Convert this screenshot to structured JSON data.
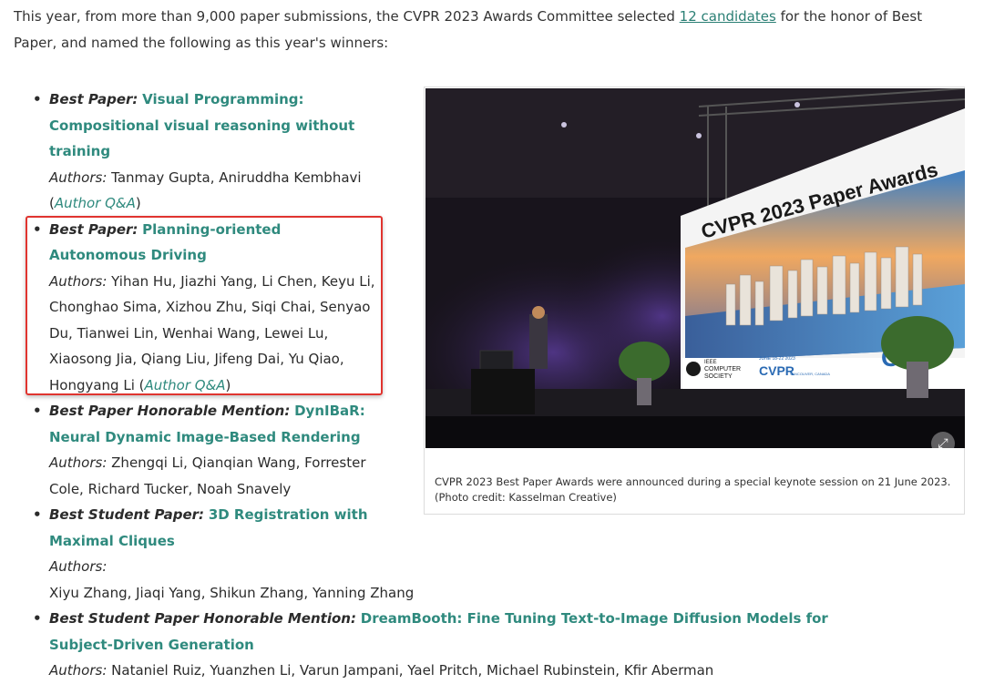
{
  "intro": {
    "text_before": "This year, from more than 9,000 paper submissions, the CVPR 2023 Awards Committee selected ",
    "link": "12 candidates",
    "text_after": " for the honor of Best Paper, and named the following as this year's winners:"
  },
  "awards": [
    {
      "kind": "Best Paper:",
      "title": "Visual Programming: Compositional visual reasoning without training",
      "authors_label": "Authors:",
      "authors": "Tanmay Gupta, Aniruddha Kembhavi",
      "qa": "Author Q&A"
    },
    {
      "kind": "Best Paper:",
      "title": "Planning-oriented Autonomous Driving",
      "authors_label": "Authors:",
      "authors": "Yihan Hu, Jiazhi Yang, Li Chen, Keyu Li, Chonghao Sima, Xizhou Zhu, Siqi Chai, Senyao Du, Tianwei Lin, Wenhai Wang, Lewei Lu, Xiaosong Jia, Qiang Liu, Jifeng Dai, Yu Qiao, Hongyang Li",
      "qa": "Author Q&A"
    },
    {
      "kind": "Best Paper Honorable Mention:",
      "title": "DynIBaR: Neural Dynamic Image-Based Rendering",
      "authors_label": "Authors:",
      "authors": "Zhengqi Li, Qianqian Wang, Forrester Cole, Richard Tucker, Noah Snavely"
    },
    {
      "kind": "Best Student Paper:",
      "title": "3D Registration with Maximal Cliques",
      "authors_label": "Authors:",
      "authors": "Xiyu Zhang, Jiaqi Yang, Shikun Zhang, Yanning Zhang"
    },
    {
      "kind": "Best Student Paper Honorable Mention:",
      "title": "DreamBooth: Fine Tuning Text-to-Image Diffusion Models for Subject-Driven Generation",
      "authors_label": "Authors:",
      "authors": "Nataniel Ruiz, Yuanzhen Li, Varun Jampani, Yael Pritch, Michael Rubinstein, Kfir Aberman"
    }
  ],
  "figure": {
    "screen_title": "CVPR 2023 Paper Awards",
    "society_text_1": "IEEE",
    "society_text_2": "COMPUTER",
    "society_text_3": "SOCIETY",
    "cvpr_logo": "CVPR",
    "cvpr_small": "JUNE 18-22 2023",
    "cvpr_city": "VANCOUVER, CANADA",
    "cv_logo": "CV",
    "caption": "CVPR 2023 Best Paper Awards were announced during a special keynote session on 21 June 2023. (Photo credit: Kasselman Creative)",
    "expand_icon": "expand-icon"
  }
}
